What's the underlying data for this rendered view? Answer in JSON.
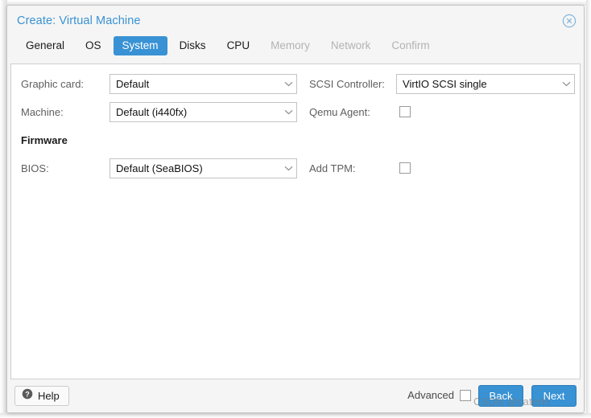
{
  "dialog": {
    "title": "Create: Virtual Machine",
    "close_icon": "close-circle-icon"
  },
  "tabs": [
    {
      "label": "General",
      "state": "enabled"
    },
    {
      "label": "OS",
      "state": "enabled"
    },
    {
      "label": "System",
      "state": "active"
    },
    {
      "label": "Disks",
      "state": "enabled"
    },
    {
      "label": "CPU",
      "state": "enabled"
    },
    {
      "label": "Memory",
      "state": "disabled"
    },
    {
      "label": "Network",
      "state": "disabled"
    },
    {
      "label": "Confirm",
      "state": "disabled"
    }
  ],
  "form": {
    "left": {
      "graphic_card": {
        "label": "Graphic card:",
        "value": "Default"
      },
      "machine": {
        "label": "Machine:",
        "value": "Default (i440fx)"
      },
      "firmware_section": "Firmware",
      "bios": {
        "label": "BIOS:",
        "value": "Default (SeaBIOS)"
      }
    },
    "right": {
      "scsi_controller": {
        "label": "SCSI Controller:",
        "value": "VirtIO SCSI single"
      },
      "qemu_agent": {
        "label": "Qemu Agent:",
        "checked": false
      },
      "add_tpm": {
        "label": "Add TPM:",
        "checked": false
      }
    }
  },
  "footer": {
    "help_label": "Help",
    "help_icon": "question-circle-icon",
    "advanced_label": "Advanced",
    "advanced_checked": false,
    "back_label": "Back",
    "next_label": "Next"
  },
  "watermark": "CSDN @caterH",
  "colors": {
    "accent": "#3892d4",
    "title_text": "#3892d4",
    "panel_bg": "#ffffff",
    "chrome_bg": "#f5f5f5",
    "label_text": "#5e5e5e",
    "disabled_tab": "#b3b3b3"
  }
}
